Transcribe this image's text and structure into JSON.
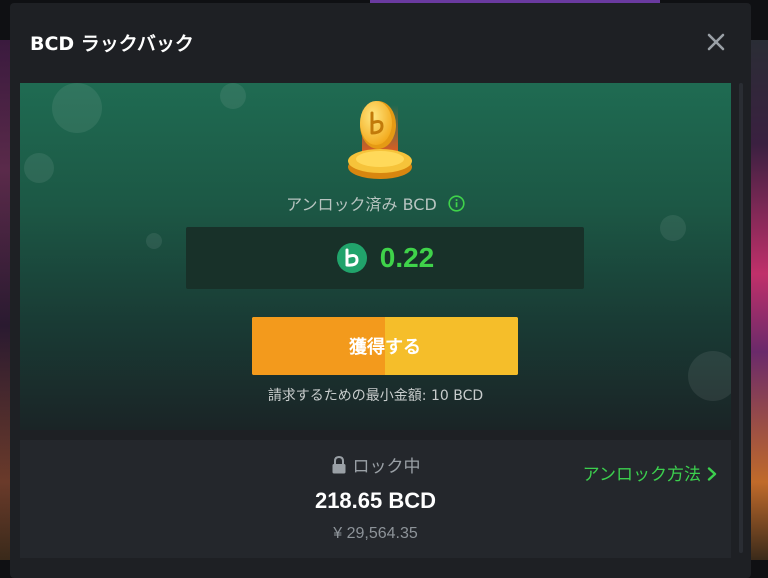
{
  "modal": {
    "title": "BCD ラックバック"
  },
  "rakeback": {
    "unlocked_label": "アンロック済み BCD",
    "unlocked_amount": "0.22",
    "claim_button_label": "獲得する",
    "min_claim_text": "請求するための最小金額: 10 BCD"
  },
  "locked": {
    "title": "ロック中",
    "amount": "218.65 BCD",
    "fiat_value": "¥ 29,564.35",
    "howto_link": "アンロック方法"
  },
  "colors": {
    "accent_green": "#3fd34a",
    "claim_button": "#f5a623",
    "panel_green": "#1f6b52"
  },
  "icons": {
    "close": "close-icon",
    "info": "info-icon",
    "coin": "bcd-coin-icon",
    "lock": "lock-icon",
    "chevron": "chevron-right-icon"
  }
}
